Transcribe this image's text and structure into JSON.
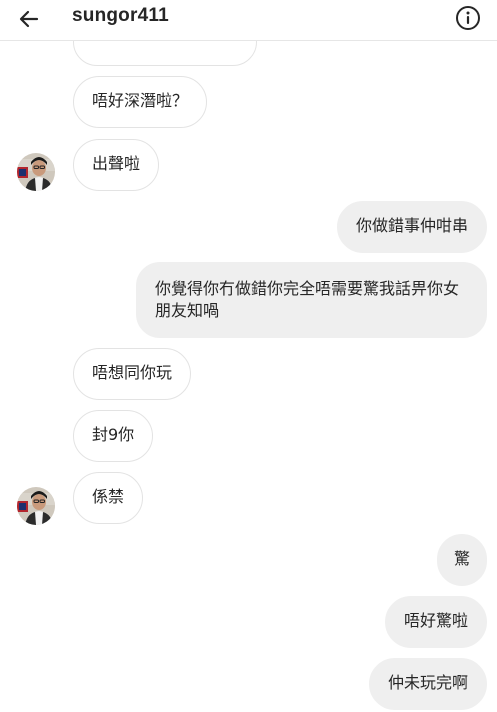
{
  "header": {
    "username": "sungor411",
    "back_icon": "arrow-left-icon",
    "info_icon": "info-circle-icon"
  },
  "messages": [
    {
      "direction": "incoming",
      "text": ""
    },
    {
      "direction": "incoming",
      "text": "唔好深潛啦？"
    },
    {
      "direction": "incoming",
      "text": "出聲啦",
      "avatar": true
    },
    {
      "direction": "outgoing",
      "text": "你做錯事仲咁串"
    },
    {
      "direction": "outgoing",
      "text": "你覺得你冇做錯你完全唔需要驚我話畀你女朋友知喎"
    },
    {
      "direction": "incoming",
      "text": "唔想同你玩"
    },
    {
      "direction": "incoming",
      "text": "封9你"
    },
    {
      "direction": "incoming",
      "text": "係禁",
      "avatar": true
    },
    {
      "direction": "outgoing",
      "text": "驚"
    },
    {
      "direction": "outgoing",
      "text": "唔好驚啦"
    },
    {
      "direction": "outgoing",
      "text": "仲未玩完啊"
    }
  ],
  "colors": {
    "incoming_bubble_border": "#e3e3e3",
    "outgoing_bubble_bg": "#efefef",
    "text": "#262626"
  }
}
